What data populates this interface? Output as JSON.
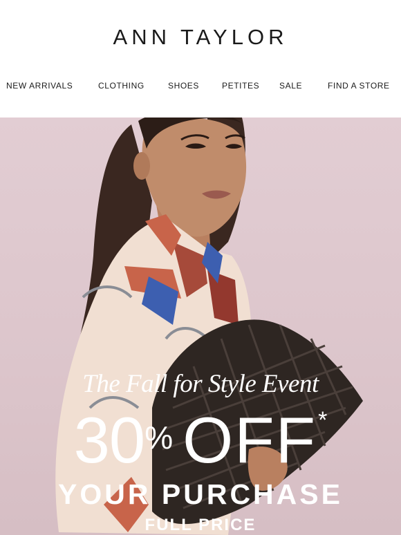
{
  "header": {
    "logo": "ANN TAYLOR",
    "nav": [
      {
        "label": "NEW ARRIVALS"
      },
      {
        "label": "CLOTHING"
      },
      {
        "label": "SHOES"
      },
      {
        "label": "PETITES"
      },
      {
        "label": "SALE"
      },
      {
        "label": "FIND A STORE"
      }
    ]
  },
  "hero": {
    "event_title": "The Fall for Style Event",
    "offer_number": "30",
    "offer_percent": "%",
    "offer_off": "OFF",
    "offer_asterisk": "*",
    "subline": "YOUR PURCHASE",
    "subline2": "FULL PRICE"
  },
  "colors": {
    "background": "#ffffff",
    "hero_background": "#dcc5cb",
    "hero_text": "#ffffff",
    "nav_text": "#1a1a1a"
  }
}
